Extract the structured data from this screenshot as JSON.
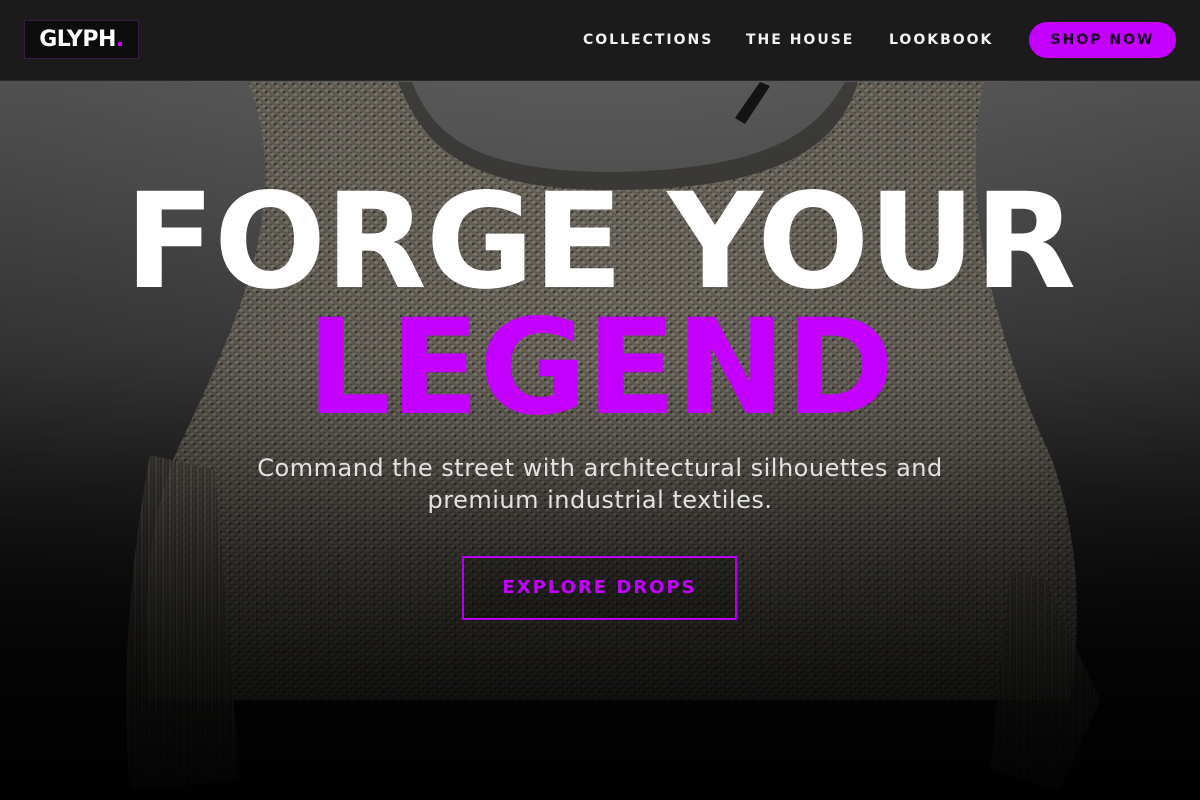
{
  "brand": {
    "logo_text": "GLYPH",
    "logo_dot": ".",
    "accent_color": "#c300ff"
  },
  "nav": {
    "links": [
      {
        "label": "COLLECTIONS"
      },
      {
        "label": "THE HOUSE"
      },
      {
        "label": "LOOKBOOK"
      }
    ],
    "cta_label": "SHOP NOW"
  },
  "hero": {
    "headline_line1": "FORGE YOUR",
    "headline_line2": "LEGEND",
    "subtitle": "Command the street with architectural silhouettes and premium industrial textiles.",
    "cta_label": "EXPLORE DROPS",
    "background_image": "knit-poncho-garment"
  }
}
